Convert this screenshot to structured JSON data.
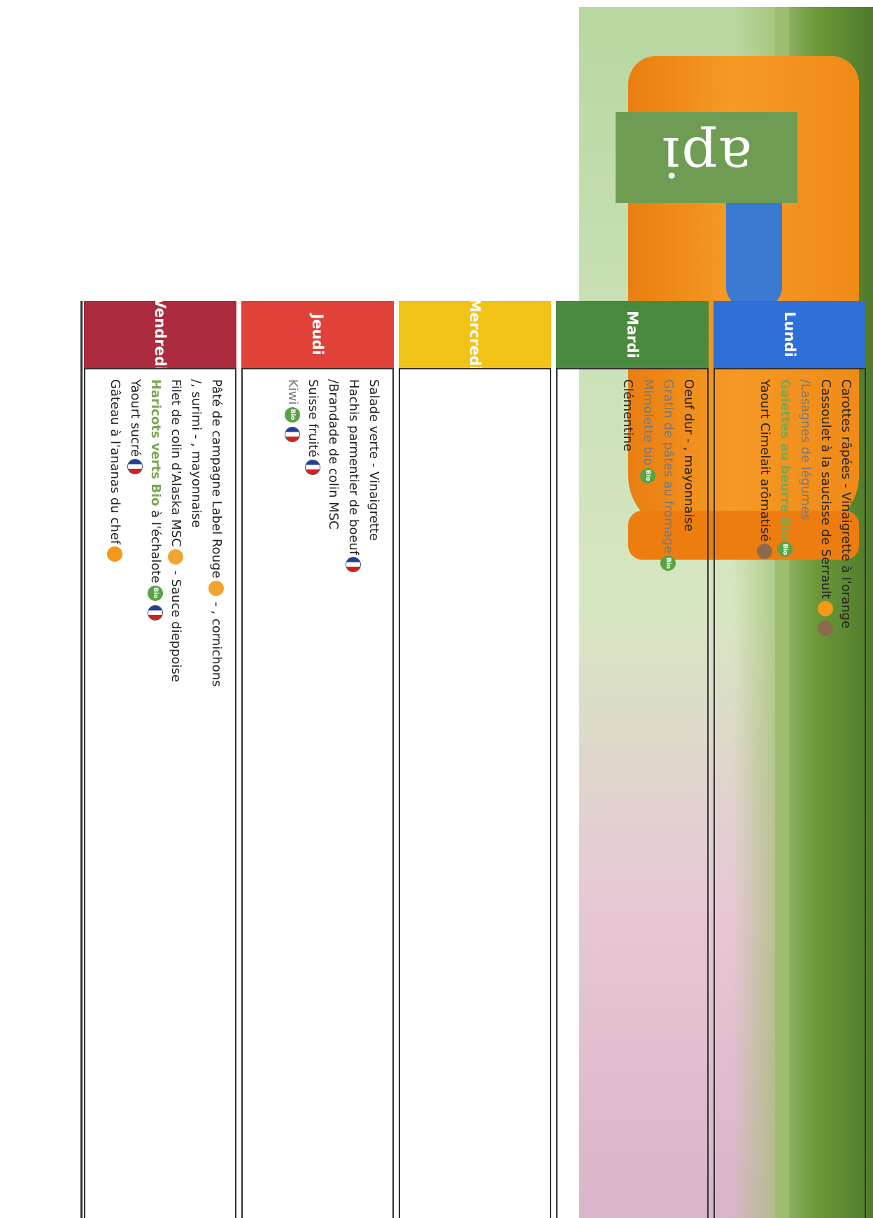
{
  "logo": {
    "text": "api"
  },
  "days": [
    {
      "name": "Lundi",
      "color": "#2f6fd8",
      "lines": [
        {
          "text": "Carottes râpées - Vinaigrette à l'orange",
          "style": "normal",
          "icons": []
        },
        {
          "text": "Cassoulet à la saucisse de Serrault",
          "style": "normal",
          "icons": [
            "chef-icon",
            "eco-icon"
          ]
        },
        {
          "text": "/Lasagnes de légumes",
          "style": "grey",
          "icons": []
        },
        {
          "text": "Galettes au beurre Bio",
          "style": "green",
          "icons": [
            "bio-icon"
          ]
        },
        {
          "text": "Yaourt Cimelait arômatisé",
          "style": "normal",
          "icons": [
            "eco-icon"
          ]
        }
      ]
    },
    {
      "name": "Mardi",
      "color": "#4a8a3e",
      "lines": [
        {
          "text": "Oeuf dur - , mayonnaise",
          "style": "normal",
          "icons": []
        },
        {
          "text": "Gratin de pâtes au fromage",
          "style": "grey",
          "icons": [
            "bio-icon"
          ]
        },
        {
          "text": "Mimolette bio",
          "style": "grey",
          "icons": [
            "bio-icon"
          ]
        },
        {
          "text": "Clémentine",
          "style": "normal",
          "icons": []
        }
      ]
    },
    {
      "name": "Mercredi",
      "color": "#f1c315",
      "lines": []
    },
    {
      "name": "Jeudi",
      "color": "#e0423a",
      "lines": [
        {
          "text": "Salade verte - Vinaigrette",
          "style": "normal",
          "icons": []
        },
        {
          "text": "Hachis parmentier de boeuf",
          "style": "normal",
          "icons": [
            "france-flag-icon"
          ]
        },
        {
          "text": "/Brandade de colin MSC",
          "style": "normal",
          "icons": []
        },
        {
          "text": "Suisse fruité",
          "style": "normal",
          "icons": [
            "france-flag-icon"
          ]
        },
        {
          "text": "Kiwi",
          "style": "grey",
          "icons": [
            "bio-icon",
            "france-flag-icon"
          ]
        }
      ]
    },
    {
      "name": "Vendredi",
      "color": "#ac2b3e",
      "lines": [
        {
          "text": "Pâté de campagne Label Rouge",
          "style": "normal",
          "icons": [
            "label-rouge-icon"
          ],
          "suffix": " - , cornichons"
        },
        {
          "text": "/, surimi - , mayonnaise",
          "style": "normal",
          "icons": []
        },
        {
          "text": "Filet de colin d'Alaska MSC",
          "style": "normal",
          "icons": [
            "msc-icon"
          ],
          "suffix": " - Sauce dieppoise"
        },
        {
          "text": "Haricots verts Bio",
          "style": "green",
          "icons": [],
          "suffix": " à l'échalote",
          "suffix_icons": [
            "bio-icon",
            "france-flag-icon"
          ]
        },
        {
          "text": "Yaourt sucré",
          "style": "normal",
          "icons": [
            "france-flag-icon"
          ]
        },
        {
          "text": "Gâteau à l'ananas du chef",
          "style": "normal",
          "icons": [
            "chef-icon"
          ]
        }
      ]
    }
  ]
}
